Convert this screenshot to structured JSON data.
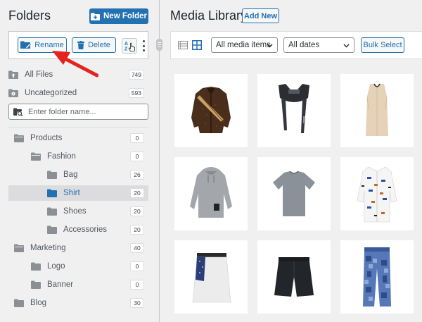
{
  "folders_panel": {
    "title": "Folders",
    "new_folder_label": "New Folder",
    "toolbar": {
      "rename_label": "Rename",
      "delete_label": "Delete",
      "sort_icon": "az-sort-icon"
    },
    "all_files": {
      "label": "All Files",
      "count": "749"
    },
    "uncategorized": {
      "label": "Uncategorized",
      "count": "593"
    },
    "search_placeholder": "Enter folder name...",
    "tree": [
      {
        "label": "Products",
        "count": "0"
      },
      {
        "label": "Fashion",
        "count": "0"
      },
      {
        "label": "Bag",
        "count": "26"
      },
      {
        "label": "Shirt",
        "count": "20"
      },
      {
        "label": "Shoes",
        "count": "20"
      },
      {
        "label": "Accessories",
        "count": "20"
      },
      {
        "label": "Marketing",
        "count": "40"
      },
      {
        "label": "Logo",
        "count": "0"
      },
      {
        "label": "Banner",
        "count": "0"
      },
      {
        "label": "Blog",
        "count": "30"
      }
    ],
    "active_folder": "Shirt"
  },
  "media_library": {
    "title": "Media Library",
    "add_new_label": "Add New",
    "filter_media": "All media items",
    "filter_dates": "All dates",
    "bulk_select_label": "Bulk Select",
    "items": [
      {
        "name": "leather-jacket"
      },
      {
        "name": "black-harness-vest"
      },
      {
        "name": "beige-sleeveless-dress"
      },
      {
        "name": "grey-hoodie"
      },
      {
        "name": "grey-tshirt"
      },
      {
        "name": "white-printed-shirt"
      },
      {
        "name": "white-skirt"
      },
      {
        "name": "black-shorts"
      },
      {
        "name": "blue-patchwork-jeans"
      }
    ]
  },
  "colors": {
    "accent": "#2271b1",
    "background": "#f0f0f1",
    "arrow": "#e32420"
  }
}
